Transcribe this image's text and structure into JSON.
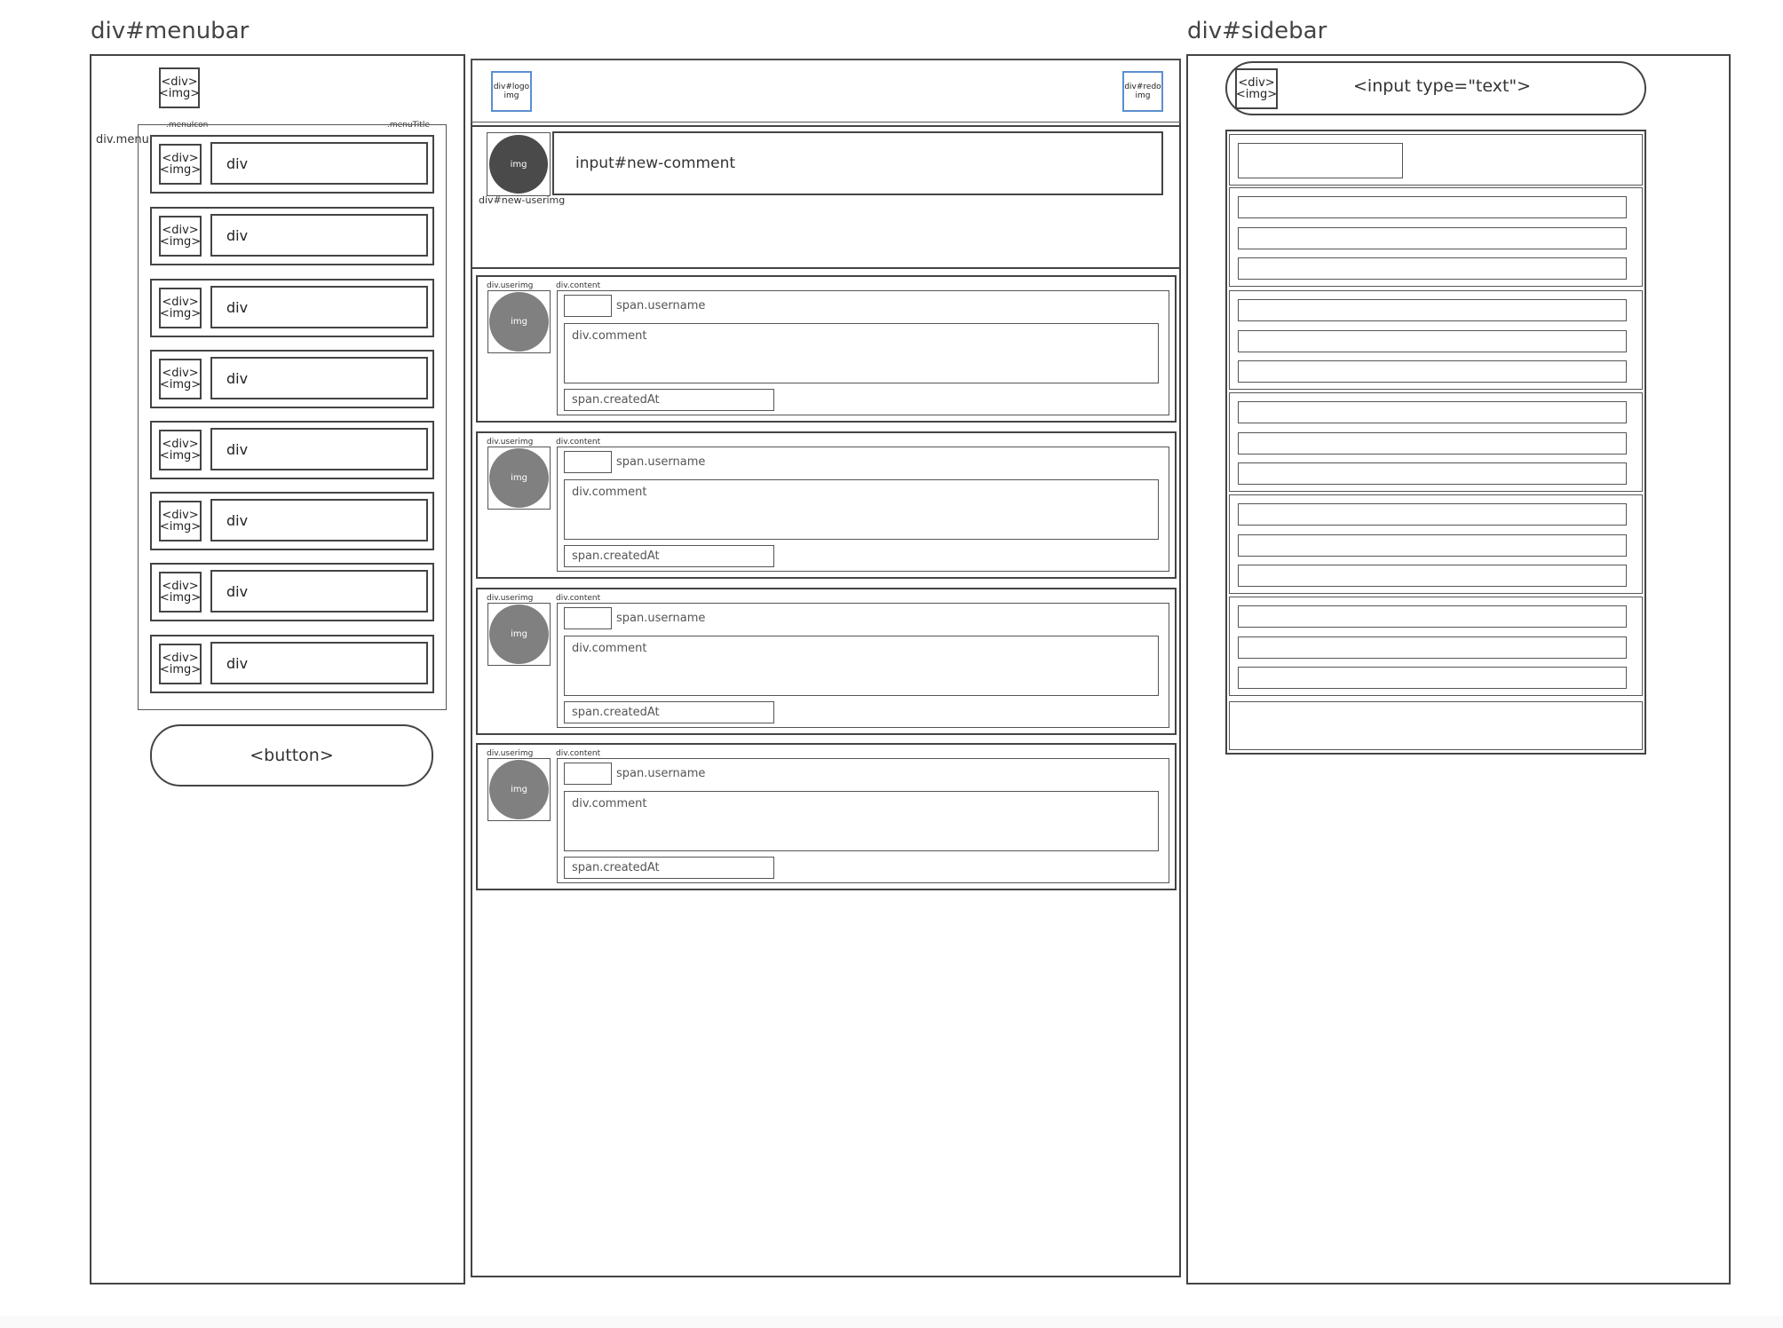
{
  "titles": {
    "menubar": "div#menubar",
    "sidebar": "div#sidebar"
  },
  "menubar": {
    "icon_lines": [
      "<div>",
      "<img>"
    ],
    "label_menu": "div.menu",
    "label_menuicon": ".menuIcon",
    "label_menutitle": ".menuTitle",
    "items": [
      {
        "icon": [
          "<div>",
          "<img>"
        ],
        "title": "div"
      },
      {
        "icon": [
          "<div>",
          "<img>"
        ],
        "title": "div"
      },
      {
        "icon": [
          "<div>",
          "<img>"
        ],
        "title": "div"
      },
      {
        "icon": [
          "<div>",
          "<img>"
        ],
        "title": "div"
      },
      {
        "icon": [
          "<div>",
          "<img>"
        ],
        "title": "div"
      },
      {
        "icon": [
          "<div>",
          "<img>"
        ],
        "title": "div"
      },
      {
        "icon": [
          "<div>",
          "<img>"
        ],
        "title": "div"
      },
      {
        "icon": [
          "<div>",
          "<img>"
        ],
        "title": "div"
      }
    ],
    "button": "<button>"
  },
  "center": {
    "logo": [
      "div#logo",
      "img"
    ],
    "redo": [
      "div#redo",
      "img"
    ],
    "new_userimg_img": "img",
    "new_userimg_label": "div#new-userimg",
    "new_comment": "input#new-comment",
    "comments": [
      {
        "userimg_label": "div.userimg",
        "content_label": "div.content",
        "img": "img",
        "username": "span.username",
        "comment": "div.comment",
        "created": "span.createdAt"
      },
      {
        "userimg_label": "div.userimg",
        "content_label": "div.content",
        "img": "img",
        "username": "span.username",
        "comment": "div.comment",
        "created": "span.createdAt"
      },
      {
        "userimg_label": "div.userimg",
        "content_label": "div.content",
        "img": "img",
        "username": "span.username",
        "comment": "div.comment",
        "created": "span.createdAt"
      },
      {
        "userimg_label": "div.userimg",
        "content_label": "div.content",
        "img": "img",
        "username": "span.username",
        "comment": "div.comment",
        "created": "span.createdAt"
      }
    ]
  },
  "sidebar": {
    "search_icon": [
      "<div>",
      "<img>"
    ],
    "search_input": "<input type=\"text\">"
  },
  "colors": {
    "line": "#444444",
    "accent_blue": "#5b8fd0",
    "new_avatar": "#4a4a4a",
    "comment_avatar": "#808080"
  }
}
